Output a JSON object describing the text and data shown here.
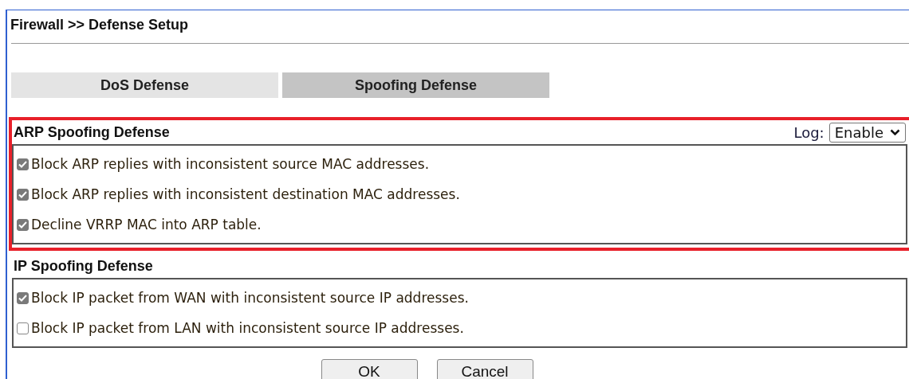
{
  "title": "Firewall >> Defense Setup",
  "tabs": [
    {
      "label": "DoS Defense",
      "selected": false
    },
    {
      "label": "Spoofing Defense",
      "selected": true
    }
  ],
  "sections": [
    {
      "title": "ARP Spoofing Defense",
      "highlighted": true,
      "log": {
        "label": "Log:",
        "value": "Enable"
      },
      "options": [
        {
          "label": "Block ARP replies with inconsistent source MAC addresses.",
          "checked": true
        },
        {
          "label": "Block ARP replies with inconsistent destination MAC addresses.",
          "checked": true
        },
        {
          "label": "Decline VRRP MAC into ARP table.",
          "checked": true
        }
      ]
    },
    {
      "title": "IP Spoofing Defense",
      "highlighted": false,
      "options": [
        {
          "label": "Block IP packet from WAN with inconsistent source IP addresses.",
          "checked": true
        },
        {
          "label": "Block IP packet from LAN with inconsistent source IP addresses.",
          "checked": false
        }
      ]
    }
  ],
  "buttons": [
    "OK",
    "Cancel"
  ]
}
